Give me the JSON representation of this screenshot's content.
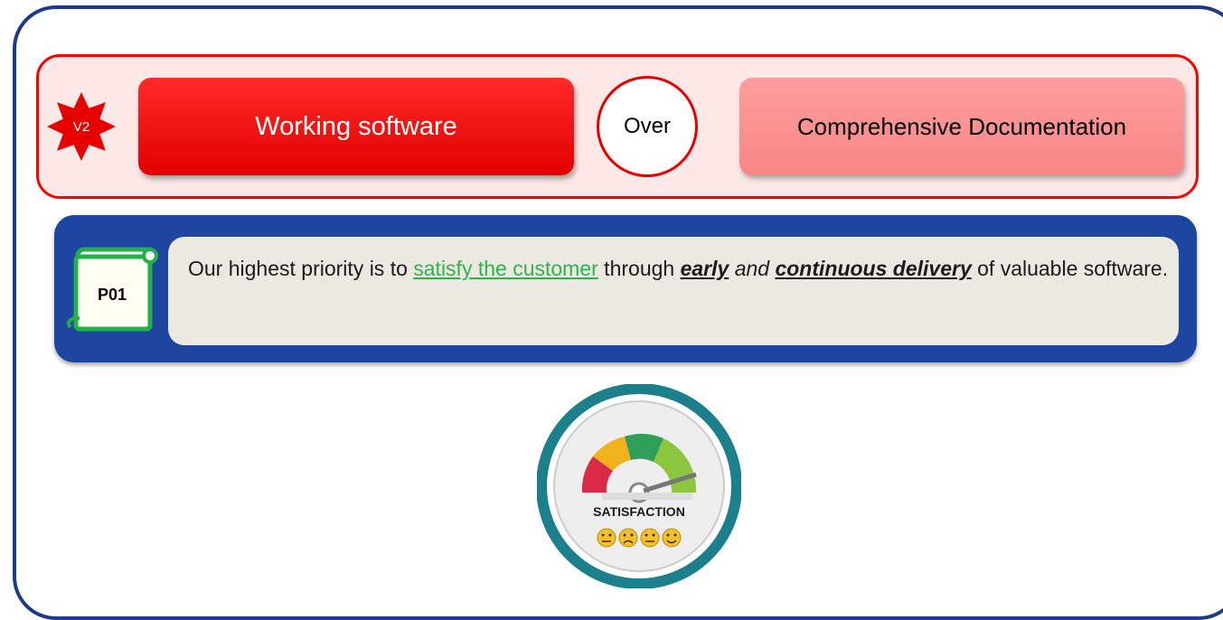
{
  "value": {
    "badge": "V2",
    "primary": "Working software",
    "connector": "Over",
    "secondary": "Comprehensive Documentation"
  },
  "principle": {
    "id": "P01",
    "text_before": "Our highest priority is to ",
    "highlight_1": "satisfy the customer",
    "text_middle": " through ",
    "highlight_2": "early",
    "text_and": " and ",
    "highlight_3": "continuous delivery",
    "text_after": " of valuable software."
  },
  "gauge": {
    "label": "SATISFACTION",
    "icon": "satisfaction-gauge-icon"
  },
  "colors": {
    "frame_border": "#1e3a8a",
    "value_border": "#ff0000",
    "primary_fill": "#e60000",
    "secondary_fill": "#f78585",
    "principle_band": "#1e45a0",
    "scroll_green": "#22b04b"
  }
}
